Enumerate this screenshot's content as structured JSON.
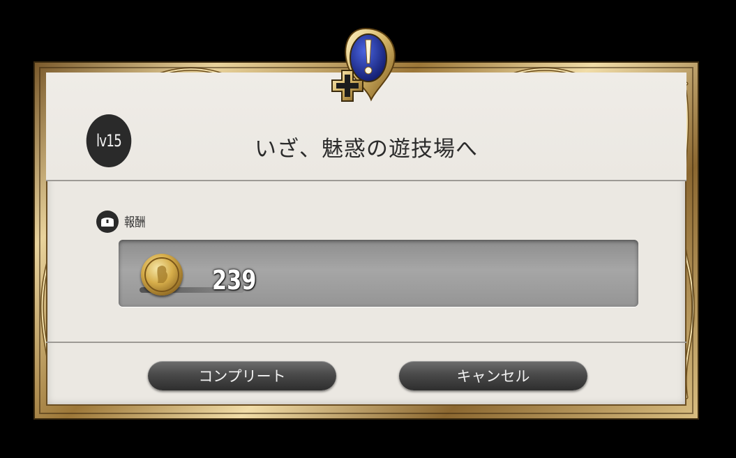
{
  "dialog": {
    "level": "lv15",
    "title": "いざ、魅惑の遊技場へ"
  },
  "reward": {
    "label": "報酬",
    "count": "239",
    "icon": "gold-coin-icon"
  },
  "buttons": {
    "complete_label": "コンプリート",
    "cancel_label": "キャンセル"
  },
  "emblem": {
    "icon": "quest-plus-exclamation-icon",
    "accent": "#1e2e9c",
    "gold": "#d7b86a"
  }
}
